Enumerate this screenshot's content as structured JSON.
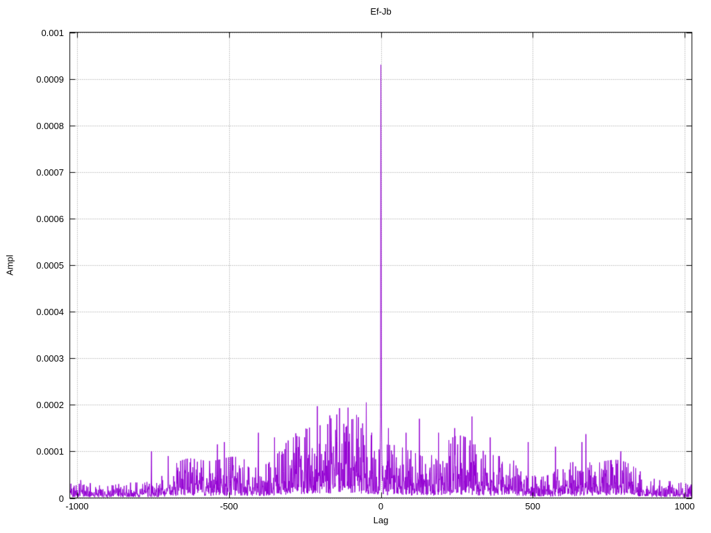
{
  "figure": {
    "background_color": "#ffffff",
    "frame_color": "#000000"
  },
  "chart_data": {
    "type": "line",
    "title": "Ef-Jb",
    "xlabel": "Lag",
    "ylabel": "Ampl",
    "xlim": [
      -1024,
      1024
    ],
    "ylim": [
      0,
      0.001
    ],
    "xticks": [
      -1000,
      -500,
      0,
      500,
      1000
    ],
    "xtick_labels": [
      "-1000",
      "-500",
      "0",
      "500",
      "1000"
    ],
    "yticks": [
      0,
      0.0001,
      0.0002,
      0.0003,
      0.0004,
      0.0005,
      0.0006,
      0.0007,
      0.0008,
      0.0009,
      0.001
    ],
    "ytick_labels": [
      "0",
      "0.0001",
      "0.0002",
      "0.0003",
      "0.0004",
      "0.0005",
      "0.0006",
      "0.0007",
      "0.0008",
      "0.0009",
      "0.001"
    ],
    "grid": "dotted",
    "grid_color": "#909090",
    "line_color": "#9400d3",
    "legend": "none",
    "n_points": 2049,
    "main_peak": {
      "lag": 0,
      "ampl": 0.00093
    },
    "secondary_peak": {
      "lag": 1,
      "ampl": 0.0006
    },
    "notable_peaks": [
      {
        "lag": -755,
        "ampl": 0.0001
      },
      {
        "lag": -700,
        "ampl": 9e-05
      },
      {
        "lag": -538,
        "ampl": 0.000115
      },
      {
        "lag": -515,
        "ampl": 0.00012
      },
      {
        "lag": -403,
        "ampl": 0.00014
      },
      {
        "lag": -350,
        "ampl": 0.00013
      },
      {
        "lag": -288,
        "ampl": 0.00013
      },
      {
        "lag": -209,
        "ampl": 0.000197
      },
      {
        "lag": -120,
        "ampl": 0.00014
      },
      {
        "lag": -65,
        "ampl": 0.00015
      },
      {
        "lag": -30,
        "ampl": 0.00014
      },
      {
        "lag": -1,
        "ampl": 0.00017
      },
      {
        "lag": 2,
        "ampl": 0.00019
      },
      {
        "lag": 25,
        "ampl": 0.00015
      },
      {
        "lag": 83,
        "ampl": 0.00014
      },
      {
        "lag": 127,
        "ampl": 0.00017
      },
      {
        "lag": 190,
        "ampl": 0.00014
      },
      {
        "lag": 243,
        "ampl": 0.00015
      },
      {
        "lag": 300,
        "ampl": 0.000175
      },
      {
        "lag": 360,
        "ampl": 0.00013
      },
      {
        "lag": 485,
        "ampl": 0.00012
      },
      {
        "lag": 575,
        "ampl": 0.00011
      },
      {
        "lag": 662,
        "ampl": 0.00012
      },
      {
        "lag": 675,
        "ampl": 0.000137
      },
      {
        "lag": 790,
        "ampl": 0.0001
      }
    ],
    "noise_envelope": {
      "seed": 42,
      "lag_from": -1024,
      "lag_to": 1024,
      "center_amplitude": 7.5e-05,
      "edge_amplitude": 1.65e-05
    }
  }
}
